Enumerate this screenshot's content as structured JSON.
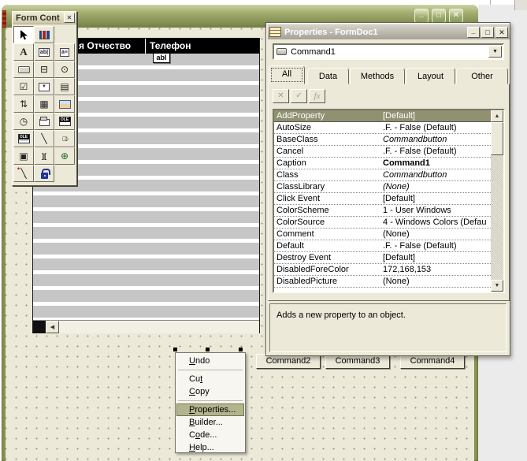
{
  "window": {
    "title": "",
    "caption_buttons": {
      "minimize": "_",
      "maximize": "□",
      "close": "✕"
    }
  },
  "form_controls_toolbar": {
    "title": "Form Cont",
    "close_glyph": "✕",
    "icons": [
      {
        "name": "select-pointer-icon",
        "glyph": "↖"
      },
      {
        "name": "view-classes-icon",
        "glyph": ""
      },
      {
        "name": "label-icon",
        "glyph": "A"
      },
      {
        "name": "textbox-icon",
        "glyph": "ab|"
      },
      {
        "name": "editbox-icon",
        "glyph": "a≡"
      },
      {
        "name": "commandbutton-icon",
        "glyph": ""
      },
      {
        "name": "commandgroup-icon",
        "glyph": "⊟"
      },
      {
        "name": "optiongroup-icon",
        "glyph": "⊙"
      },
      {
        "name": "checkbox-icon",
        "glyph": "☑"
      },
      {
        "name": "combobox-icon",
        "glyph": "▼"
      },
      {
        "name": "listbox-icon",
        "glyph": "▤"
      },
      {
        "name": "spinner-icon",
        "glyph": "⇅"
      },
      {
        "name": "grid-icon",
        "glyph": "▦"
      },
      {
        "name": "image-icon",
        "glyph": ""
      },
      {
        "name": "timer-icon",
        "glyph": "◷"
      },
      {
        "name": "pageframe-icon",
        "glyph": ""
      },
      {
        "name": "ole-container-icon",
        "glyph": "OLE"
      },
      {
        "name": "ole-bound-icon",
        "glyph": "OLE"
      },
      {
        "name": "line-icon",
        "glyph": "╲"
      },
      {
        "name": "shape-icon",
        "glyph": "□○"
      },
      {
        "name": "container-icon",
        "glyph": "▣"
      },
      {
        "name": "separator-icon",
        "glyph": "]["
      },
      {
        "name": "hyperlink-icon",
        "glyph": "⊕"
      },
      {
        "name": "builder-lock-icon",
        "glyph": "╲"
      },
      {
        "name": "button-lock-icon",
        "glyph": ""
      }
    ]
  },
  "form": {
    "grid_headers": [
      "я Отчество",
      "Телефон"
    ],
    "grid_scroll_left_glyph": "◀",
    "drag_badge": "abl",
    "buttons": [
      "Command2",
      "Command3",
      "Command4"
    ]
  },
  "properties_window": {
    "title": "Properties - FormDoc1",
    "caption_buttons": {
      "minimize": "_",
      "maximize": "□",
      "close": "✕"
    },
    "object_selector": "Command1",
    "dropdown_glyph": "▼",
    "tabs": [
      "All",
      "Data",
      "Methods",
      "Layout",
      "Other"
    ],
    "edit_buttons": [
      {
        "name": "cancel",
        "glyph": "✕"
      },
      {
        "name": "accept",
        "glyph": "✓"
      },
      {
        "name": "expression",
        "glyph": "fx"
      }
    ],
    "scrollbar": {
      "up": "▲",
      "down": "▼"
    },
    "properties": [
      {
        "name": "AddProperty",
        "value": "[Default]"
      },
      {
        "name": "AutoSize",
        "value": ".F. - False (Default)"
      },
      {
        "name": "BaseClass",
        "value": "Commandbutton"
      },
      {
        "name": "Cancel",
        "value": ".F. - False (Default)"
      },
      {
        "name": "Caption",
        "value": "Command1"
      },
      {
        "name": "Class",
        "value": "Commandbutton"
      },
      {
        "name": "ClassLibrary",
        "value": "(None)"
      },
      {
        "name": "Click Event",
        "value": "[Default]"
      },
      {
        "name": "ColorScheme",
        "value": "1 - User Windows"
      },
      {
        "name": "ColorSource",
        "value": "4 - Windows Colors (Defau"
      },
      {
        "name": "Comment",
        "value": "(None)"
      },
      {
        "name": "Default",
        "value": ".F. - False (Default)"
      },
      {
        "name": "Destroy Event",
        "value": "[Default]"
      },
      {
        "name": "DisabledForeColor",
        "value": "172,168,153"
      },
      {
        "name": "DisabledPicture",
        "value": "(None)"
      }
    ],
    "description": "Adds a new property to an object."
  },
  "context_menu": {
    "items": [
      {
        "pre": "",
        "key": "U",
        "post": "ndo"
      },
      {
        "pre": "Cu",
        "key": "t",
        "post": ""
      },
      {
        "pre": "",
        "key": "C",
        "post": "opy"
      },
      {
        "pre": "",
        "key": "P",
        "post": "roperties..."
      },
      {
        "pre": "",
        "key": "B",
        "post": "uilder..."
      },
      {
        "pre": "C",
        "key": "o",
        "post": "de..."
      },
      {
        "pre": "",
        "key": "H",
        "post": "elp..."
      }
    ]
  },
  "colors": {
    "titlebar_olive": "#9aa568",
    "surface_tan": "#ece9d8",
    "selection_olive": "#8f9170",
    "menu_highlight": "#b2b48c",
    "grid_header_bg": "#000000",
    "grid_stripe_gray": "#c6c6c6",
    "disabled_glyph": "#a09d90"
  }
}
